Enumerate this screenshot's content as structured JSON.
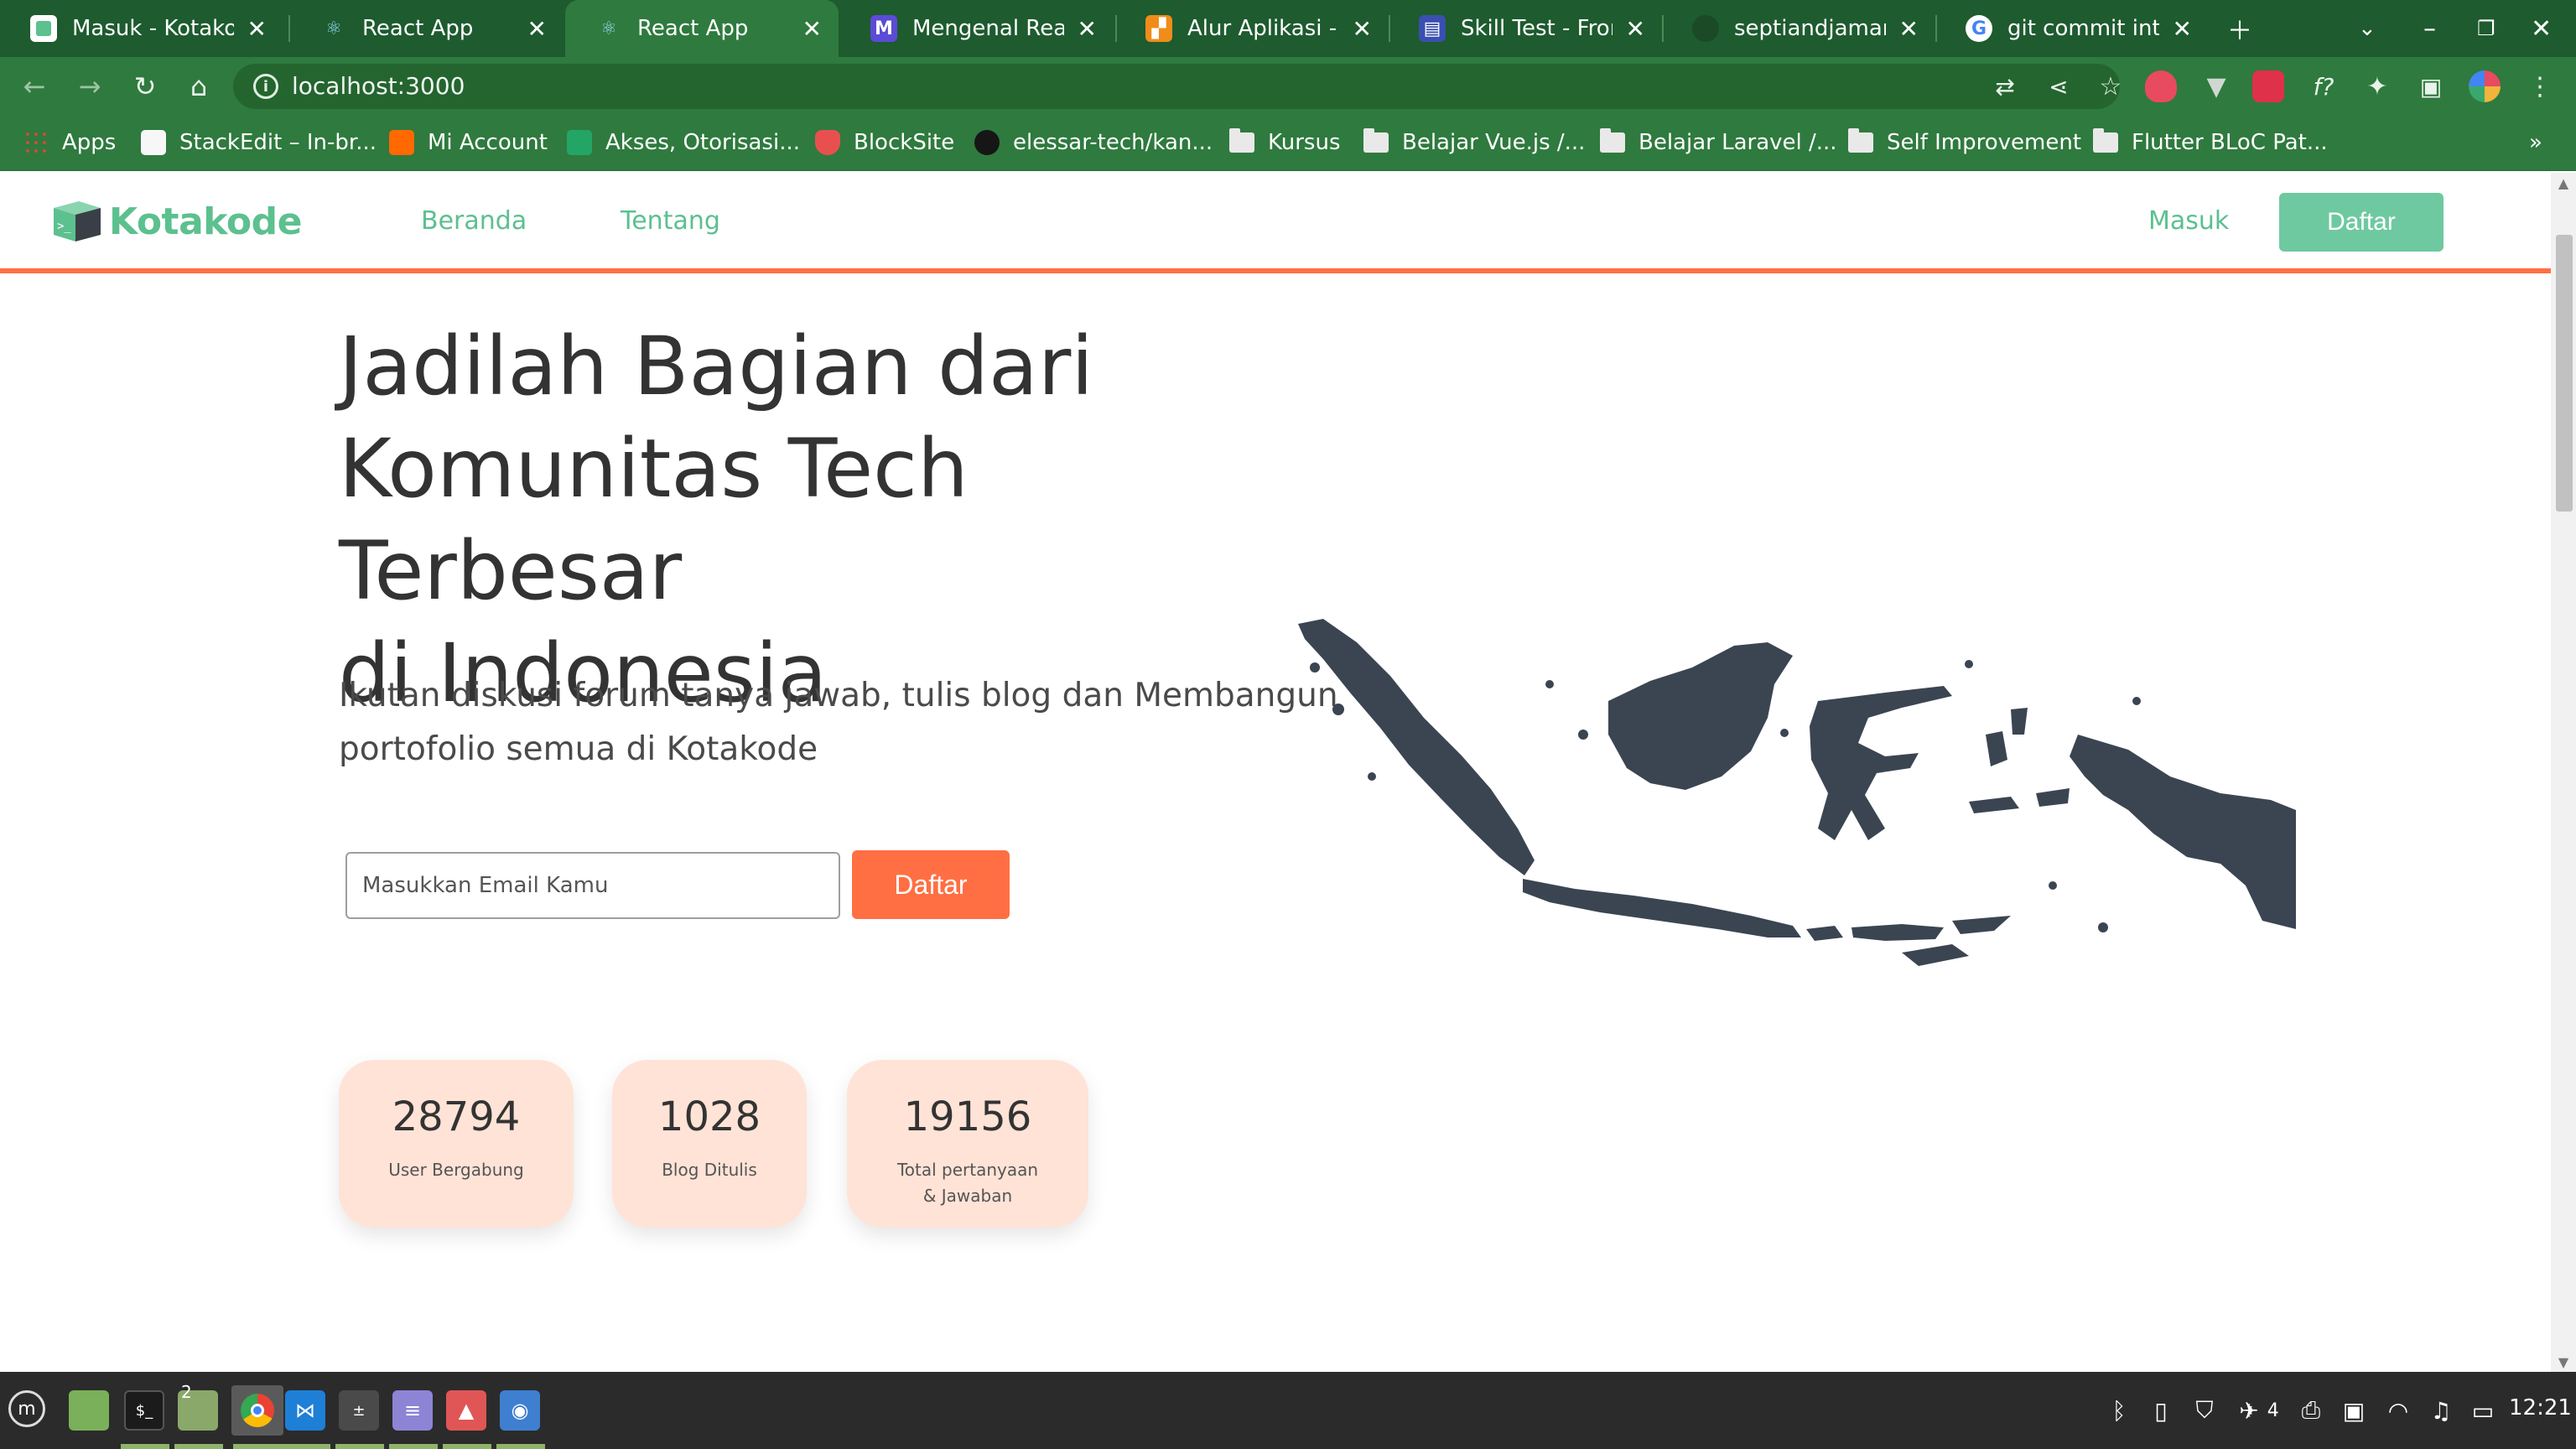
{
  "browser": {
    "tabs": [
      {
        "title": "Masuk - Kotakode",
        "icon": "kotakode-favicon",
        "active": false
      },
      {
        "title": "React App",
        "icon": "react-favicon",
        "active": false
      },
      {
        "title": "React App",
        "icon": "react-favicon",
        "active": true
      },
      {
        "title": "Mengenal React",
        "icon": "m-favicon",
        "active": false
      },
      {
        "title": "Alur Aplikasi - di",
        "icon": "diagram-favicon",
        "active": false
      },
      {
        "title": "Skill Test - Fronte",
        "icon": "form-favicon",
        "active": false
      },
      {
        "title": "septiandjamari/S",
        "icon": "github-favicon",
        "active": false
      },
      {
        "title": "git commit into a",
        "icon": "google-favicon",
        "active": false
      }
    ],
    "url": "localhost:3000",
    "bookmarks": [
      {
        "label": "Apps",
        "icon": "apps-grid-icon"
      },
      {
        "label": "StackEdit – In-br...",
        "icon": "stackedit-icon"
      },
      {
        "label": "Mi Account",
        "icon": "mi-icon"
      },
      {
        "label": "Akses, Otorisasi...",
        "icon": "sheets-icon"
      },
      {
        "label": "BlockSite",
        "icon": "blocksite-icon"
      },
      {
        "label": "elessar-tech/kan...",
        "icon": "github-icon"
      },
      {
        "label": "Kursus",
        "icon": "folder-icon"
      },
      {
        "label": "Belajar Vue.js /...",
        "icon": "folder-icon"
      },
      {
        "label": "Belajar Laravel /...",
        "icon": "folder-icon"
      },
      {
        "label": "Self Improvement",
        "icon": "folder-icon"
      },
      {
        "label": "Flutter BLoC Pat...",
        "icon": "folder-icon"
      }
    ],
    "bookmarks_overflow": "»"
  },
  "site": {
    "brand": "Kotakode",
    "nav": {
      "beranda": "Beranda",
      "tentang": "Tentang",
      "masuk": "Masuk",
      "daftar": "Daftar"
    },
    "hero": {
      "title_line1": "Jadilah Bagian dari",
      "title_line2": "Komunitas Tech Terbesar",
      "title_line3": "di Indonesia",
      "subtitle": "Ikutan diskusi forum tanya jawab, tulis blog dan Membangun portofolio semua di Kotakode",
      "email_placeholder": "Masukkan Email Kamu",
      "cta": "Daftar"
    },
    "stats": [
      {
        "value": "28794",
        "label": "User Bergabung"
      },
      {
        "value": "1028",
        "label": "Blog Ditulis"
      },
      {
        "value": "19156",
        "label": "Total pertanyaan & Jawaban"
      }
    ],
    "colors": {
      "brand_green": "#5cc08f",
      "accent_orange": "#ff6f43",
      "stat_bg": "#ffe3d6",
      "map": "#3b4552"
    }
  },
  "taskbar": {
    "workspace_badge": "2",
    "notification_count": "4",
    "clock": "12:21"
  }
}
